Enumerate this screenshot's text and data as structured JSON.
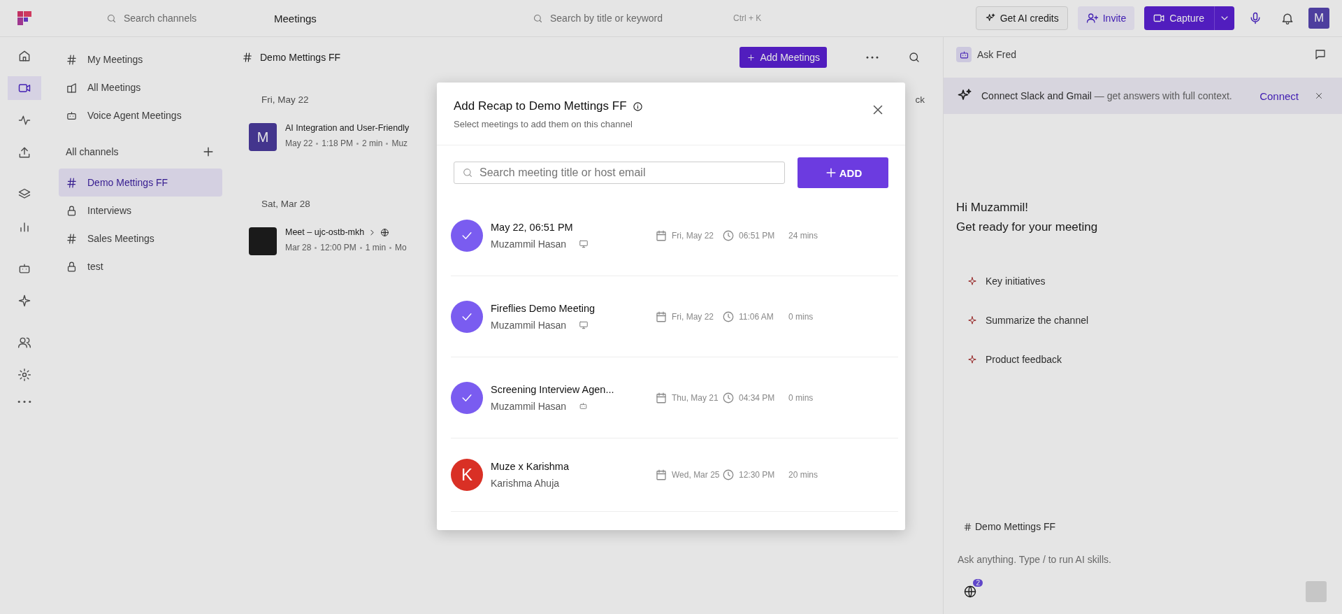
{
  "top_bar": {
    "channel_search": {
      "placeholder": "Search channels"
    },
    "title": "Meetings",
    "search": {
      "placeholder": "Search by title or keyword"
    },
    "shortcut": "Ctrl + K",
    "credits_button": "Get AI credits",
    "invite_button": "Invite",
    "capture_button": "Capture",
    "avatar": "M"
  },
  "rail": {
    "items": [
      {
        "kind": "home",
        "selected": false
      },
      {
        "kind": "video",
        "selected": true
      },
      {
        "kind": "activity",
        "selected": false
      },
      {
        "kind": "upload",
        "selected": false
      },
      {
        "kind": "layers",
        "selected": false
      },
      {
        "kind": "chart",
        "selected": false
      },
      {
        "kind": "bot",
        "selected": false
      },
      {
        "kind": "sparkle",
        "selected": false
      },
      {
        "kind": "people",
        "selected": false
      },
      {
        "kind": "settings",
        "selected": false
      },
      {
        "kind": "more",
        "selected": false
      }
    ]
  },
  "sidebar": {
    "items": [
      {
        "kind": "hash",
        "label": "My Meetings"
      },
      {
        "kind": "building",
        "label": "All Meetings"
      },
      {
        "kind": "bot",
        "label": "Voice Agent Meetings"
      }
    ],
    "channels_heading": "All channels",
    "channels": [
      {
        "kind": "hash",
        "label": "Demo Mettings FF",
        "selected": true
      },
      {
        "kind": "lock",
        "label": "Interviews",
        "selected": false
      },
      {
        "kind": "hash",
        "label": "Sales Meetings",
        "selected": false
      },
      {
        "kind": "lock",
        "label": "test",
        "selected": false
      }
    ]
  },
  "channel": {
    "title": "Demo Mettings FF",
    "add_button": "Add Meetings",
    "groups": [
      {
        "date": "Fri, May 22",
        "action": "ck",
        "meetings": [
          {
            "kind": "letter",
            "avatar": "M",
            "title": "AI Integration and User-Friendly",
            "meta": [
              "May 22",
              "1:18 PM",
              "2 min",
              "Muz"
            ]
          }
        ]
      },
      {
        "date": "Sat, Mar 28",
        "meetings": [
          {
            "kind": "photo",
            "title": "Meet – ujc-ostb-mkh",
            "meta": [
              "Mar 28",
              "12:00 PM",
              "1 min",
              "Mo"
            ]
          }
        ]
      }
    ]
  },
  "assistant": {
    "title": "Ask Fred",
    "banner": {
      "text": "**Connect Slack and Gmail** — get answers with full context.",
      "action": "Connect"
    },
    "greeting": "Hi Muzammil!",
    "subgreeting": "Get ready for your meeting",
    "suggestions": [
      "Key initiatives",
      "Summarize the channel",
      "Product feedback"
    ],
    "channel_chip": "Demo Mettings FF",
    "input": {
      "placeholder": "Ask anything. Type / to run AI skills."
    },
    "badge": "2"
  },
  "modal": {
    "title": "Add Recap to Demo Mettings FF",
    "subtitle": "Select meetings to add them on this channel",
    "search": {
      "placeholder": "Search meeting title or host email"
    },
    "add_button": "ADD",
    "rows": [
      {
        "selected": true,
        "title": "May 22, 06:51 PM",
        "host": "Muzammil Hasan",
        "kind": "desktop",
        "date": "Fri, May 22",
        "time": "06:51 PM",
        "duration": "24 mins"
      },
      {
        "selected": true,
        "title": "Fireflies Demo Meeting",
        "host": "Muzammil Hasan",
        "kind": "desktop",
        "date": "Fri, May 22",
        "time": "11:06 AM",
        "duration": "0 mins"
      },
      {
        "selected": true,
        "title": "Screening Interview Agen...",
        "host": "Muzammil Hasan",
        "kind": "bot",
        "date": "Thu, May 21",
        "time": "04:34 PM",
        "duration": "0 mins"
      },
      {
        "selected": false,
        "avatar": "K",
        "color": "#d93025",
        "title": "Muze x Karishma",
        "host": "Karishma Ahuja",
        "kind": "plain",
        "date": "Wed, Mar 25",
        "time": "12:30 PM",
        "duration": "20 mins"
      }
    ]
  }
}
